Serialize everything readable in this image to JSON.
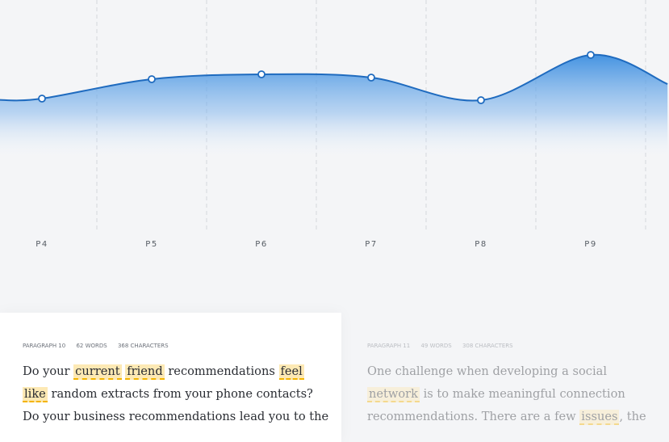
{
  "chart_data": {
    "type": "area",
    "categories": [
      "P4",
      "P5",
      "P6",
      "P7",
      "P8",
      "P9"
    ],
    "values": [
      0.34,
      0.46,
      0.49,
      0.47,
      0.33,
      0.61
    ],
    "ylim": [
      0,
      1
    ],
    "grid": "vertical-dashed",
    "line_color": "#1f6bbf",
    "fill_color": "#3b8ee0"
  },
  "cards": [
    {
      "meta": {
        "paragraph": "PARAGRAPH 10",
        "words": "62 WORDS",
        "chars": "368 CHARACTERS"
      },
      "segments": [
        {
          "t": "Do your "
        },
        {
          "t": "current",
          "h": true
        },
        {
          "t": " "
        },
        {
          "t": "friend",
          "h": true
        },
        {
          "t": " recommendations "
        },
        {
          "t": "feel",
          "h": true
        },
        {
          "t": " "
        },
        {
          "t": "like",
          "h": true
        },
        {
          "t": " random extracts from your phone contacts? Do your business recommendations lead you to the"
        }
      ]
    },
    {
      "meta": {
        "paragraph": "PARAGRAPH 11",
        "words": "49 WORDS",
        "chars": "308 CHARACTERS"
      },
      "segments": [
        {
          "t": "One challenge when developing a social "
        },
        {
          "t": "network",
          "h": true
        },
        {
          "t": " is to make meaningful connection recommendations. There are  a few "
        },
        {
          "t": "issues",
          "h": true
        },
        {
          "t": ", the"
        }
      ]
    }
  ]
}
